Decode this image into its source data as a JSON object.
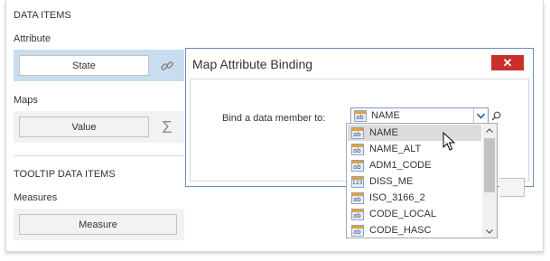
{
  "data_items": {
    "header": "DATA ITEMS",
    "attribute_label": "Attribute",
    "attribute_value": "State",
    "maps_label": "Maps",
    "maps_value": "Value"
  },
  "tooltip_items": {
    "header": "TOOLTIP DATA ITEMS",
    "measures_label": "Measures",
    "measure_value": "Measure"
  },
  "dialog": {
    "title": "Map Attribute Binding",
    "close_glyph": "✕",
    "bind_label": "Bind a data member to:",
    "selected_value": "NAME",
    "selected_icon_text": "ab"
  },
  "dropdown": {
    "items": [
      {
        "label": "NAME",
        "icon": "ab"
      },
      {
        "label": "NAME_ALT",
        "icon": "ab"
      },
      {
        "label": "ADM1_CODE",
        "icon": "ab"
      },
      {
        "label": "DISS_ME",
        "icon": "123"
      },
      {
        "label": "ISO_3166_2",
        "icon": "ab"
      },
      {
        "label": "CODE_LOCAL",
        "icon": "ab"
      },
      {
        "label": "CODE_HASC",
        "icon": "ab"
      }
    ],
    "hovered_index": 0
  },
  "icons": {
    "link": "link-icon",
    "sum": "sigma-icon",
    "search": "search-icon",
    "dropdown": "chevron-down-icon"
  },
  "colors": {
    "selected_row": "#c9ddf1",
    "close_button": "#c9302c",
    "dialog_border": "#6b8fb8"
  }
}
